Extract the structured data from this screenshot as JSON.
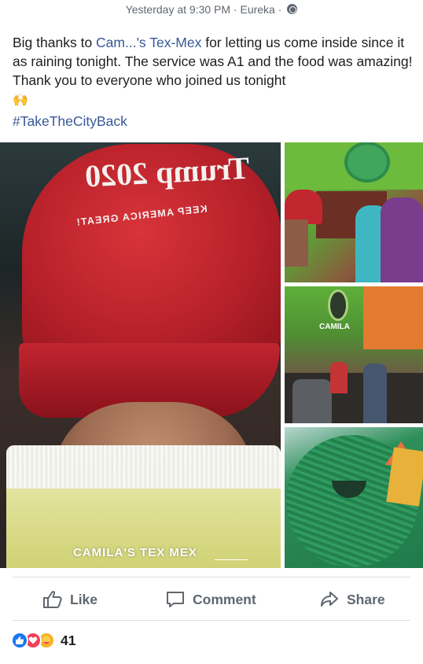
{
  "post": {
    "meta": "Yesterday at 9:30 PM · Eureka ·",
    "text_before_link": "Big thanks to ",
    "business_link": "Cam...'s Tex-Mex",
    "text_after_link": " for letting us come inside since it as raining tonight. The service was A1 and the food was amazing! Thank you to everyone who joined us tonight",
    "emoji": "🙌",
    "hashtag": "#TakeTheCityBack"
  },
  "photos": {
    "main_cap_line1": "Trump 2020",
    "main_cap_line2": "KEEP AMERICA GREAT!",
    "main_location": "CAMILA'S TEX MEX",
    "side2_sign": "CAMILA"
  },
  "actions": {
    "like": "Like",
    "comment": "Comment",
    "share": "Share"
  },
  "reactions": {
    "count": "41",
    "types": [
      "like-icon",
      "love-icon",
      "care-icon"
    ]
  },
  "colors": {
    "link": "#385898",
    "muted": "#606770",
    "like_blue": "#1877f2",
    "love_red": "#f33e58"
  }
}
